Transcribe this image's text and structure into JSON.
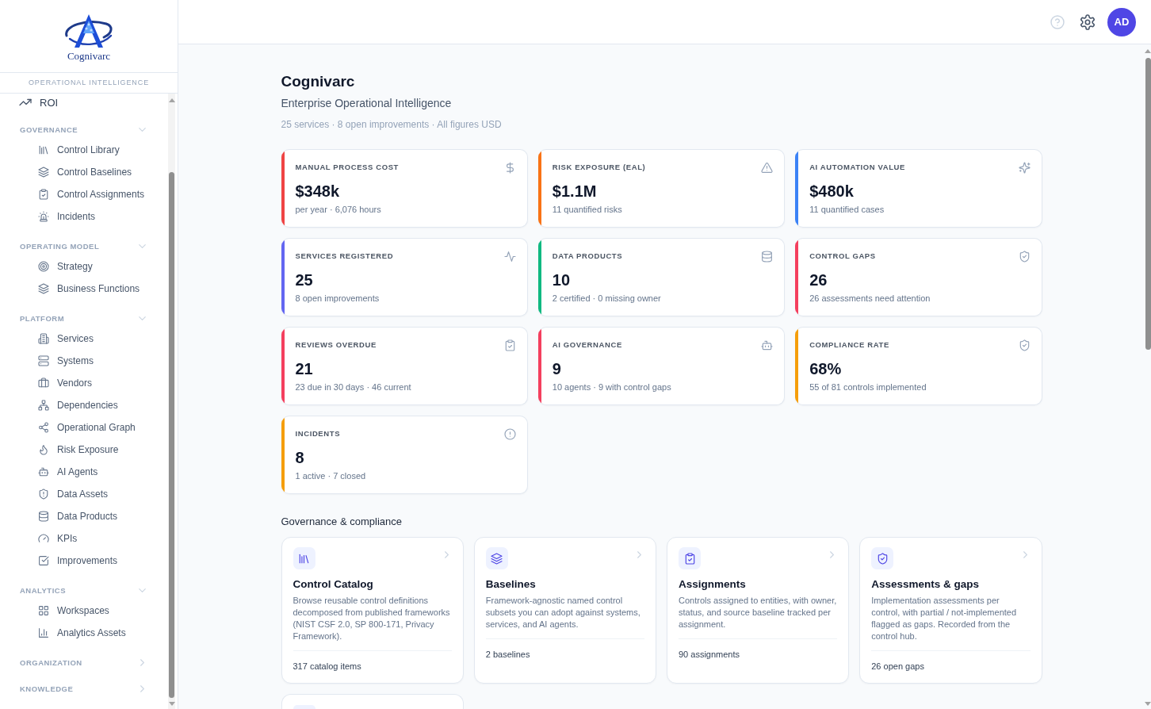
{
  "sidebar": {
    "logo_text": "Cognivarc",
    "tagline": "OPERATIONAL INTELLIGENCE",
    "top_items": [
      {
        "label": "ROI",
        "selected": false
      }
    ],
    "sections": [
      {
        "title": "GOVERNANCE",
        "expanded": true,
        "items": [
          {
            "label": "Control Library",
            "selected": false
          },
          {
            "label": "Control Baselines",
            "selected": false
          },
          {
            "label": "Control Assignments",
            "selected": false
          },
          {
            "label": "Incidents",
            "selected": false
          }
        ]
      },
      {
        "title": "OPERATING MODEL",
        "expanded": true,
        "items": [
          {
            "label": "Strategy",
            "selected": false
          },
          {
            "label": "Business Functions",
            "selected": false
          }
        ]
      },
      {
        "title": "PLATFORM",
        "expanded": true,
        "items": [
          {
            "label": "Services",
            "selected": false
          },
          {
            "label": "Systems",
            "selected": false
          },
          {
            "label": "Vendors",
            "selected": false
          },
          {
            "label": "Dependencies",
            "selected": false
          },
          {
            "label": "Operational Graph",
            "selected": false
          },
          {
            "label": "Risk Exposure",
            "selected": false
          },
          {
            "label": "AI Agents",
            "selected": false
          },
          {
            "label": "Data Assets",
            "selected": false
          },
          {
            "label": "Data Products",
            "selected": false
          },
          {
            "label": "KPIs",
            "selected": false
          },
          {
            "label": "Improvements",
            "selected": false
          }
        ]
      },
      {
        "title": "ANALYTICS",
        "expanded": true,
        "items": [
          {
            "label": "Workspaces",
            "selected": false
          },
          {
            "label": "Analytics Assets",
            "selected": false
          }
        ]
      },
      {
        "title": "ORGANIZATION",
        "expanded": false
      },
      {
        "title": "KNOWLEDGE",
        "expanded": false
      }
    ]
  },
  "top_bar": {
    "avatar_initials": "AD"
  },
  "page": {
    "title": "Cognivarc",
    "subtitle": "Enterprise Operational Intelligence",
    "meta": "25 services · 8 open improvements · All figures USD"
  },
  "metrics": [
    {
      "label": "MANUAL PROCESS COST",
      "value": "$348k",
      "note": "per year · 6,076 hours",
      "color": "#ef4444"
    },
    {
      "label": "RISK EXPOSURE (EAL)",
      "value": "$1.1M",
      "note": "11 quantified risks",
      "color": "#f97316"
    },
    {
      "label": "AI AUTOMATION VALUE",
      "value": "$480k",
      "note": "11 quantified cases",
      "color": "#3b82f6"
    },
    {
      "label": "SERVICES REGISTERED",
      "value": "25",
      "note": "8 open improvements",
      "color": "#6366f1"
    },
    {
      "label": "DATA PRODUCTS",
      "value": "10",
      "note": "2 certified · 0 missing owner",
      "color": "#10b981"
    },
    {
      "label": "CONTROL GAPS",
      "value": "26",
      "note": "26 assessments need attention",
      "color": "#f43f5e"
    },
    {
      "label": "REVIEWS OVERDUE",
      "value": "21",
      "note": "23 due in 30 days · 46 current",
      "color": "#f43f5e"
    },
    {
      "label": "AI GOVERNANCE",
      "value": "9",
      "note": "10 agents · 9 with control gaps",
      "color": "#f43f5e"
    },
    {
      "label": "COMPLIANCE RATE",
      "value": "68%",
      "note": "55 of 81 controls implemented",
      "color": "#f59e0b"
    },
    {
      "label": "INCIDENTS",
      "value": "8",
      "note": "1 active · 7 closed",
      "color": "#f59e0b"
    }
  ],
  "governance": {
    "heading": "Governance & compliance",
    "cards": [
      {
        "title": "Control Catalog",
        "description": "Browse reusable control definitions decomposed from published frameworks (NIST CSF 2.0, SP 800-171, Privacy Framework).",
        "footer": "317 catalog items"
      },
      {
        "title": "Baselines",
        "description": "Framework-agnostic named control subsets you can adopt against systems, services, and AI agents.",
        "footer": "2 baselines"
      },
      {
        "title": "Assignments",
        "description": "Controls assigned to entities, with owner, status, and source baseline tracked per assignment.",
        "footer": "90 assignments"
      },
      {
        "title": "Assessments & gaps",
        "description": "Implementation assessments per control, with partial / not-implemented flagged as gaps. Recorded from the control hub.",
        "footer": "26 open gaps"
      }
    ]
  }
}
